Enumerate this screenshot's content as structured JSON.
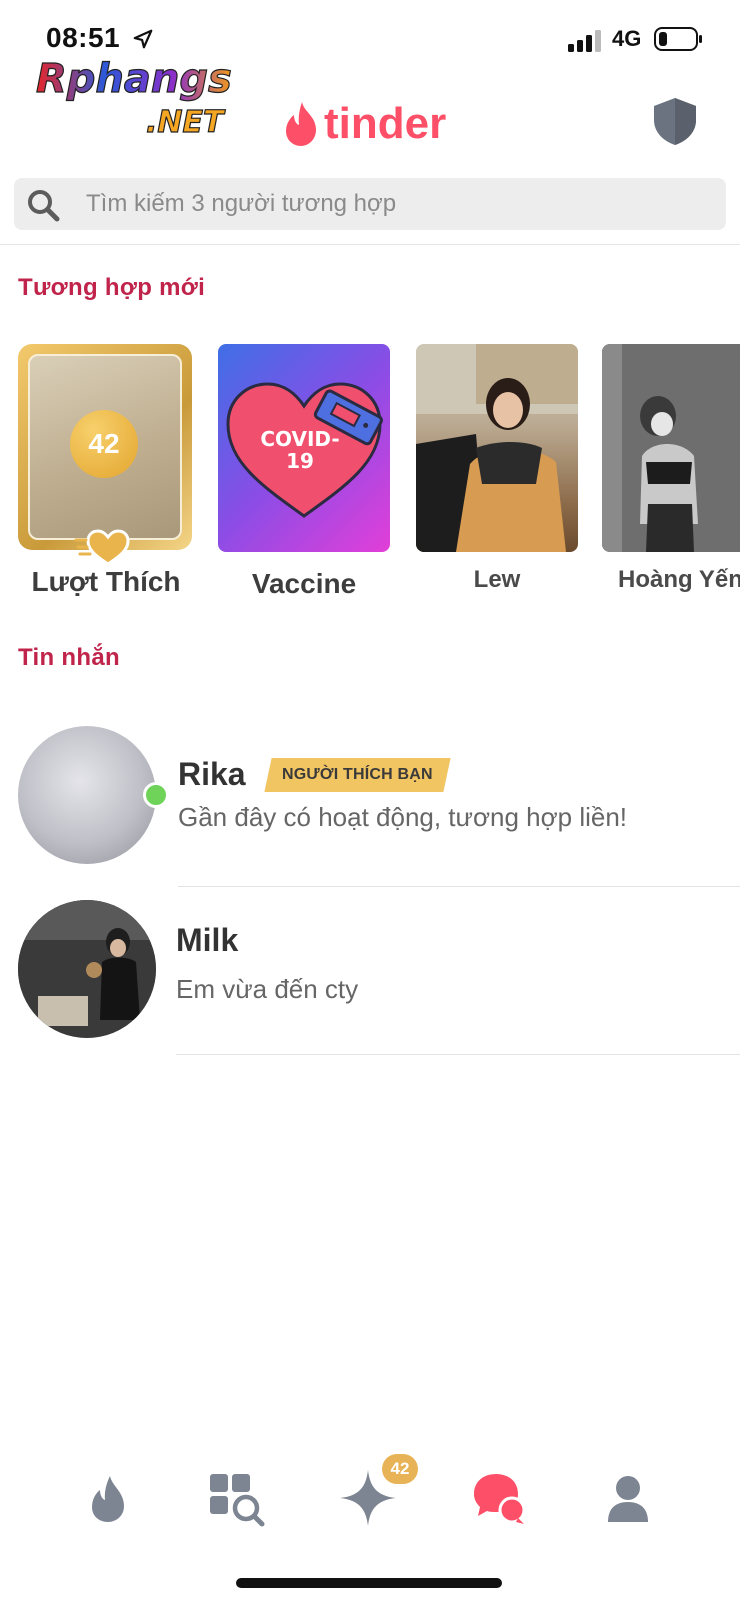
{
  "status_bar": {
    "time": "08:51",
    "network": "4G"
  },
  "watermark": {
    "line1": "Rphangs",
    "line2": ".NET"
  },
  "header": {
    "logo_text": "tinder"
  },
  "search": {
    "placeholder": "Tìm kiếm 3 người tương hợp"
  },
  "new_matches": {
    "title": "Tương hợp mới",
    "likes": {
      "label": "Lượt Thích",
      "count": "42"
    },
    "cards": [
      {
        "label": "Vaccine",
        "sticker_text": "COVID-19"
      },
      {
        "label": "Lew"
      },
      {
        "label": "Hoàng Yến"
      }
    ]
  },
  "messages": {
    "title": "Tin nhắn",
    "rows": [
      {
        "name": "Rika",
        "badge": "NGƯỜI THÍCH BẠN",
        "preview": "Gần đây có hoạt động, tương hợp liền!",
        "online": true
      },
      {
        "name": "Milk",
        "preview": "Em vừa đến cty"
      }
    ]
  },
  "bottom_nav": {
    "items": [
      "flame-icon",
      "explore-icon",
      "gold-star-icon",
      "messages-icon",
      "profile-icon"
    ],
    "active": "messages-icon",
    "gold_badge": "42"
  },
  "colors": {
    "brand": "#fd5068",
    "section_title": "#c0244a",
    "gold": "#f2c563",
    "online": "#6fd35a",
    "nav_inactive": "#7c8591"
  }
}
